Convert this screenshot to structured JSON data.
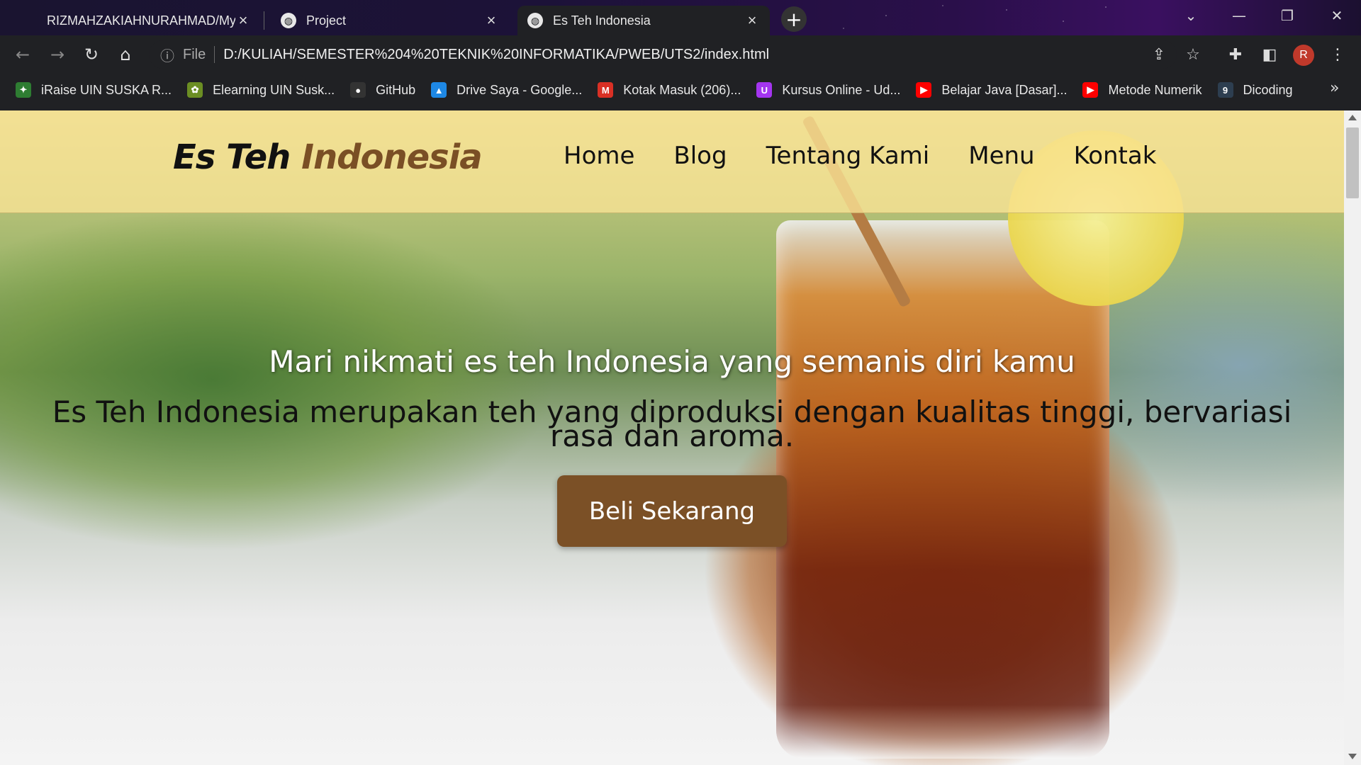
{
  "browser": {
    "tabs": [
      {
        "title": "RIZMAHZAKIAHNURAHMAD/My",
        "active": false
      },
      {
        "title": "Project",
        "active": false
      },
      {
        "title": "Es Teh Indonesia",
        "active": true
      }
    ],
    "address": {
      "scheme_label": "File",
      "url": "D:/KULIAH/SEMESTER%204%20TEKNIK%20INFORMATIKA/PWEB/UTS2/index.html"
    },
    "profile_initial": "R",
    "bookmarks": [
      {
        "label": "iRaise UIN SUSKA R...",
        "icon": "iraise-icon",
        "color": "#2e7d32"
      },
      {
        "label": "Elearning UIN Susk...",
        "icon": "elearning-icon",
        "color": "#6b8e23"
      },
      {
        "label": "GitHub",
        "icon": "github-icon",
        "color": "#333333"
      },
      {
        "label": "Drive Saya - Google...",
        "icon": "google-drive-icon",
        "color": "#1e88e5"
      },
      {
        "label": "Kotak Masuk (206)...",
        "icon": "gmail-icon",
        "color": "#d93025"
      },
      {
        "label": "Kursus Online - Ud...",
        "icon": "udemy-icon",
        "color": "#a435f0"
      },
      {
        "label": "Belajar Java [Dasar]...",
        "icon": "youtube-icon",
        "color": "#ff0000"
      },
      {
        "label": "Metode Numerik",
        "icon": "youtube-icon",
        "color": "#ff0000"
      },
      {
        "label": "Dicoding",
        "icon": "dicoding-icon",
        "color": "#2d3e50"
      }
    ],
    "more_bookmarks": "»"
  },
  "site": {
    "brand_part1": "Es Teh",
    "brand_part2": "Indonesia",
    "nav": [
      "Home",
      "Blog",
      "Tentang Kami",
      "Menu",
      "Kontak"
    ],
    "hero_subtitle": "Mari nikmati es teh Indonesia yang semanis diri kamu",
    "hero_description": "Es Teh Indonesia merupakan teh yang diproduksi dengan kualitas tinggi, bervariasi rasa dan aroma.",
    "cta_label": "Beli Sekarang",
    "colors": {
      "accent": "#7b5026",
      "navbar_bg": "#fae496"
    }
  }
}
